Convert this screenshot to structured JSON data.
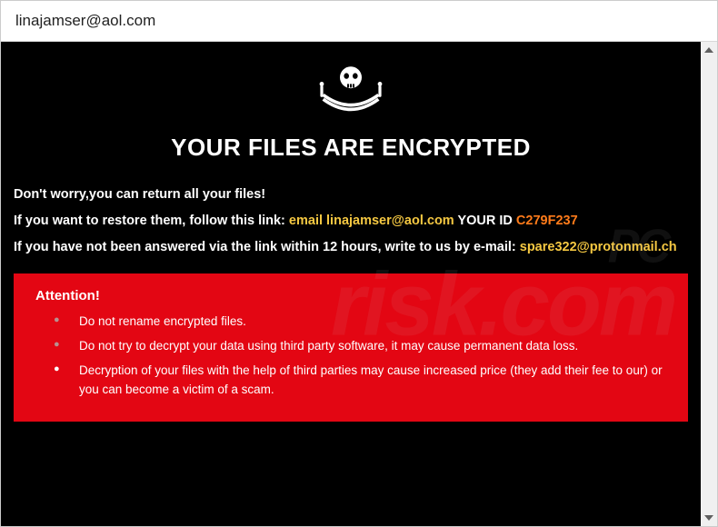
{
  "window": {
    "title": "linajamser@aol.com"
  },
  "main": {
    "heading": "YOUR FILES ARE ENCRYPTED",
    "line1": "Don't worry,you can return all your files!",
    "line2_prefix": "If you want to restore them, follow this link: ",
    "line2_email_label": "email linajamser@aol.com",
    "line2_yourid_label": "  YOUR ID ",
    "line2_id": "C279F237",
    "line3_prefix": "If you have not been answered via the link within 12 hours, write to us by e-mail: ",
    "line3_email": "spare322@protonmail.ch"
  },
  "attention": {
    "title": "Attention!",
    "items": [
      "Do not rename encrypted files.",
      "Do not try to decrypt your data using third party software, it may cause permanent data loss.",
      "Decryption of your files with the help of third parties may cause increased price (they add their fee to our) or you can become a victim of a scam."
    ]
  },
  "watermark": {
    "top": "PC",
    "bottom": "risk.com"
  },
  "icons": {
    "pirate": "pirate-skull-crossed-swords"
  }
}
